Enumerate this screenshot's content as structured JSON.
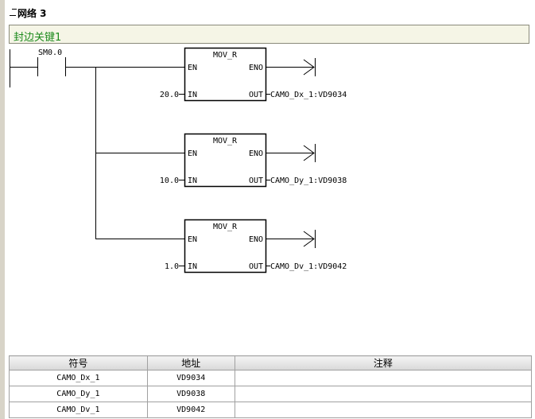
{
  "network": {
    "label": "网络 3",
    "comment": "封边关键1"
  },
  "contact": {
    "address": "SM0.0"
  },
  "boxes": [
    {
      "title": "MOV_R",
      "en": "EN",
      "eno": "ENO",
      "in_pin": "IN",
      "out_pin": "OUT",
      "in_value": "20.0",
      "out_value": "CAMO_Dx_1:VD9034"
    },
    {
      "title": "MOV_R",
      "en": "EN",
      "eno": "ENO",
      "in_pin": "IN",
      "out_pin": "OUT",
      "in_value": "10.0",
      "out_value": "CAMO_Dy_1:VD9038"
    },
    {
      "title": "MOV_R",
      "en": "EN",
      "eno": "ENO",
      "in_pin": "IN",
      "out_pin": "OUT",
      "in_value": "1.0",
      "out_value": "CAMO_Dv_1:VD9042"
    }
  ],
  "symbol_table": {
    "headers": [
      "符号",
      "地址",
      "注释"
    ],
    "rows": [
      {
        "symbol": "CAMO_Dx_1",
        "address": "VD9034",
        "comment": ""
      },
      {
        "symbol": "CAMO_Dy_1",
        "address": "VD9038",
        "comment": ""
      },
      {
        "symbol": "CAMO_Dv_1",
        "address": "VD9042",
        "comment": ""
      }
    ]
  },
  "colors": {
    "comment_text": "#1c8a1c",
    "comment_bg": "#f5f5e6",
    "table_header": "#d8d8d8"
  }
}
